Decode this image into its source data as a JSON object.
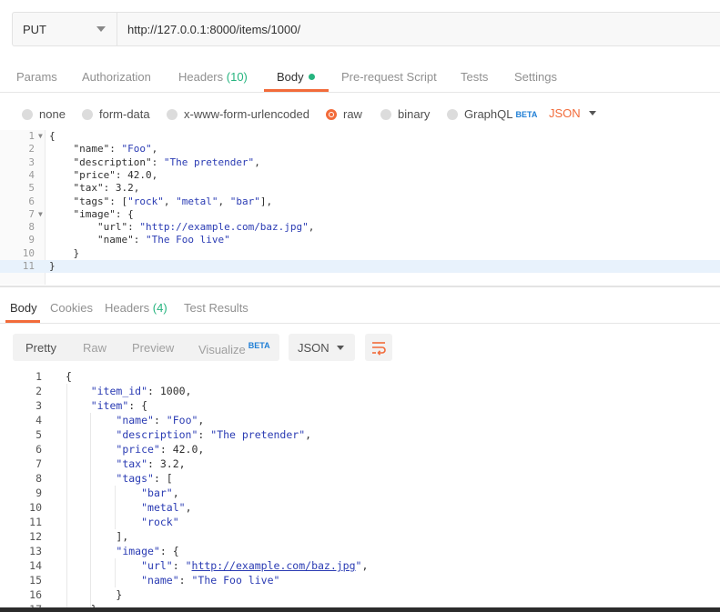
{
  "request": {
    "method": "PUT",
    "url": "http://127.0.0.1:8000/items/1000/"
  },
  "tabs": [
    {
      "label": "Params"
    },
    {
      "label": "Authorization"
    },
    {
      "label": "Headers",
      "count": "(10)"
    },
    {
      "label": "Body"
    },
    {
      "label": "Pre-request Script"
    },
    {
      "label": "Tests"
    },
    {
      "label": "Settings"
    }
  ],
  "body_types": [
    {
      "label": "none"
    },
    {
      "label": "form-data"
    },
    {
      "label": "x-www-form-urlencoded"
    },
    {
      "label": "raw"
    },
    {
      "label": "binary"
    },
    {
      "label": "GraphQL",
      "badge": "BETA"
    }
  ],
  "raw_format": "JSON",
  "request_body_lines": [
    "{",
    "    \"name\": \"Foo\",",
    "    \"description\": \"The pretender\",",
    "    \"price\": 42.0,",
    "    \"tax\": 3.2,",
    "    \"tags\": [\"rock\", \"metal\", \"bar\"],",
    "    \"image\": {",
    "        \"url\": \"http://example.com/baz.jpg\",",
    "        \"name\": \"The Foo live\"",
    "    }",
    "}"
  ],
  "response_tabs": [
    {
      "label": "Body"
    },
    {
      "label": "Cookies"
    },
    {
      "label": "Headers",
      "count": "(4)"
    },
    {
      "label": "Test Results"
    }
  ],
  "view_modes": [
    {
      "label": "Pretty"
    },
    {
      "label": "Raw"
    },
    {
      "label": "Preview"
    },
    {
      "label": "Visualize",
      "badge": "BETA"
    }
  ],
  "response_format": "JSON",
  "response_lines": [
    "{",
    "    \"item_id\": 1000,",
    "    \"item\": {",
    "        \"name\": \"Foo\",",
    "        \"description\": \"The pretender\",",
    "        \"price\": 42.0,",
    "        \"tax\": 3.2,",
    "        \"tags\": [",
    "            \"bar\",",
    "            \"metal\",",
    "            \"rock\"",
    "        ],",
    "        \"image\": {",
    "            \"url\": \"http://example.com/baz.jpg\",",
    "            \"name\": \"The Foo live\"",
    "        }",
    "    }"
  ],
  "colors": {
    "accent": "#f26b3a",
    "count_green": "#26b47f",
    "string_blue": "#2a3bb3",
    "beta_blue": "#1f7fd6"
  }
}
